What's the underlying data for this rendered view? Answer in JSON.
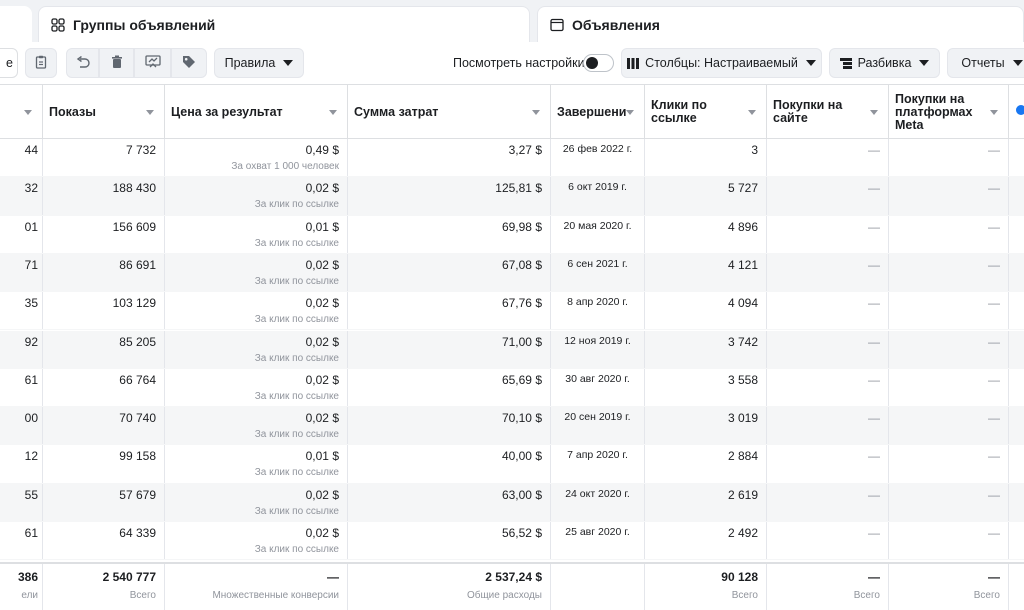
{
  "tabs": {
    "ad_sets": "Группы объявлений",
    "ads": "Объявления"
  },
  "toolbar": {
    "left_partial": "е",
    "rules": "Правила",
    "view_settings": "Посмотреть настройки",
    "columns": "Столбцы: Настраиваемый",
    "breakdown": "Разбивка",
    "reports": "Отчеты"
  },
  "headers": {
    "impressions": "Показы",
    "cost_per_result": "Цена за результат",
    "amount_spent": "Сумма затрат",
    "ends": "Завершени",
    "link_clicks": "Клики по ссылке",
    "purchases_site": "Покупки на сайте",
    "purchases_meta": "Покупки на платформах Meta"
  },
  "rows": [
    {
      "partial": "44",
      "impressions": "7 732",
      "cpr": "0,49 $",
      "cpr_sub": "За охват 1 000 человек",
      "spent": "3,27 $",
      "ends": "26 фев 2022 г.",
      "clicks": "3",
      "p_site": "—",
      "p_meta": "—"
    },
    {
      "partial": "32",
      "impressions": "188 430",
      "cpr": "0,02 $",
      "cpr_sub": "За клик по ссылке",
      "spent": "125,81 $",
      "ends": "6 окт 2019 г.",
      "clicks": "5 727",
      "p_site": "—",
      "p_meta": "—"
    },
    {
      "partial": "01",
      "impressions": "156 609",
      "cpr": "0,01 $",
      "cpr_sub": "За клик по ссылке",
      "spent": "69,98 $",
      "ends": "20 мая 2020 г.",
      "clicks": "4 896",
      "p_site": "—",
      "p_meta": "—"
    },
    {
      "partial": "71",
      "impressions": "86 691",
      "cpr": "0,02 $",
      "cpr_sub": "За клик по ссылке",
      "spent": "67,08 $",
      "ends": "6 сен 2021 г.",
      "clicks": "4 121",
      "p_site": "—",
      "p_meta": "—"
    },
    {
      "partial": "35",
      "impressions": "103 129",
      "cpr": "0,02 $",
      "cpr_sub": "За клик по ссылке",
      "spent": "67,76 $",
      "ends": "8 апр 2020 г.",
      "clicks": "4 094",
      "p_site": "—",
      "p_meta": "—"
    },
    {
      "partial": "92",
      "impressions": "85 205",
      "cpr": "0,02 $",
      "cpr_sub": "За клик по ссылке",
      "spent": "71,00 $",
      "ends": "12 ноя 2019 г.",
      "clicks": "3 742",
      "p_site": "—",
      "p_meta": "—"
    },
    {
      "partial": "61",
      "impressions": "66 764",
      "cpr": "0,02 $",
      "cpr_sub": "За клик по ссылке",
      "spent": "65,69 $",
      "ends": "30 авг 2020 г.",
      "clicks": "3 558",
      "p_site": "—",
      "p_meta": "—"
    },
    {
      "partial": "00",
      "impressions": "70 740",
      "cpr": "0,02 $",
      "cpr_sub": "За клик по ссылке",
      "spent": "70,10 $",
      "ends": "20 сен 2019 г.",
      "clicks": "3 019",
      "p_site": "—",
      "p_meta": "—"
    },
    {
      "partial": "12",
      "impressions": "99 158",
      "cpr": "0,01 $",
      "cpr_sub": "За клик по ссылке",
      "spent": "40,00 $",
      "ends": "7 апр 2020 г.",
      "clicks": "2 884",
      "p_site": "—",
      "p_meta": "—"
    },
    {
      "partial": "55",
      "impressions": "57 679",
      "cpr": "0,02 $",
      "cpr_sub": "За клик по ссылке",
      "spent": "63,00 $",
      "ends": "24 окт 2020 г.",
      "clicks": "2 619",
      "p_site": "—",
      "p_meta": "—"
    },
    {
      "partial": "61",
      "impressions": "64 339",
      "cpr": "0,02 $",
      "cpr_sub": "За клик по ссылке",
      "spent": "56,52 $",
      "ends": "25 авг 2020 г.",
      "clicks": "2 492",
      "p_site": "—",
      "p_meta": "—"
    }
  ],
  "totals": {
    "partial": "386",
    "partial_sub": "ели",
    "impressions": "2 540 777",
    "impressions_sub": "Всего",
    "cpr": "—",
    "cpr_sub": "Множественные конверсии",
    "spent": "2 537,24 $",
    "spent_sub": "Общие расходы",
    "clicks": "90 128",
    "clicks_sub": "Всего",
    "p_site": "—",
    "p_site_sub": "Всего",
    "p_meta": "—",
    "p_meta_sub": "Всего"
  },
  "colors": {
    "accent": "#1877f2",
    "border": "#dddfe2",
    "muted": "#90949c"
  }
}
